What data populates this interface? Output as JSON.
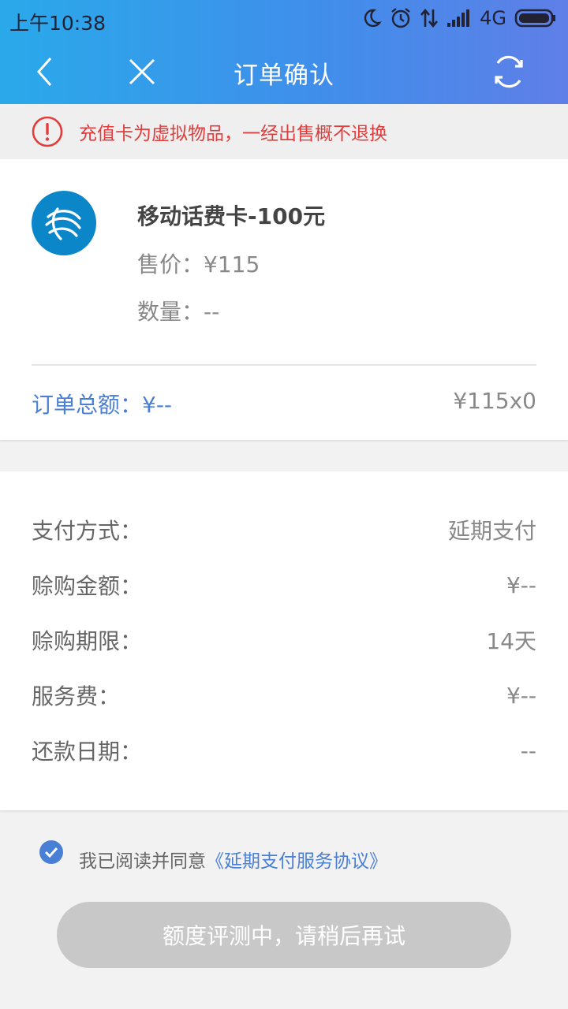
{
  "status": {
    "time": "上午10:38",
    "network": "4G"
  },
  "nav": {
    "title": "订单确认"
  },
  "notice": {
    "text": "充值卡为虚拟物品，一经出售概不退换"
  },
  "product": {
    "name": "移动话费卡-100元",
    "price_label": "售价：",
    "price_value": "¥115",
    "qty_label": "数量：",
    "qty_value": "--"
  },
  "summary": {
    "total_label": "订单总额：",
    "total_value": "¥--",
    "multiplier": "¥115x0"
  },
  "payment": {
    "rows": [
      {
        "label": "支付方式：",
        "value": "延期支付"
      },
      {
        "label": "赊购金额：",
        "value": "¥--"
      },
      {
        "label": "赊购期限：",
        "value": "14天"
      },
      {
        "label": "服务费：",
        "value": "¥--"
      },
      {
        "label": "还款日期：",
        "value": "--"
      }
    ]
  },
  "agreement": {
    "text": "我已阅读并同意",
    "link": "《延期支付服务协议》",
    "checked": true
  },
  "submit": {
    "label": "额度评测中，请稍后再试"
  },
  "colors": {
    "accent": "#4a7fd6",
    "warning": "#e23d3d",
    "brand_blue": "#0b86c9"
  }
}
